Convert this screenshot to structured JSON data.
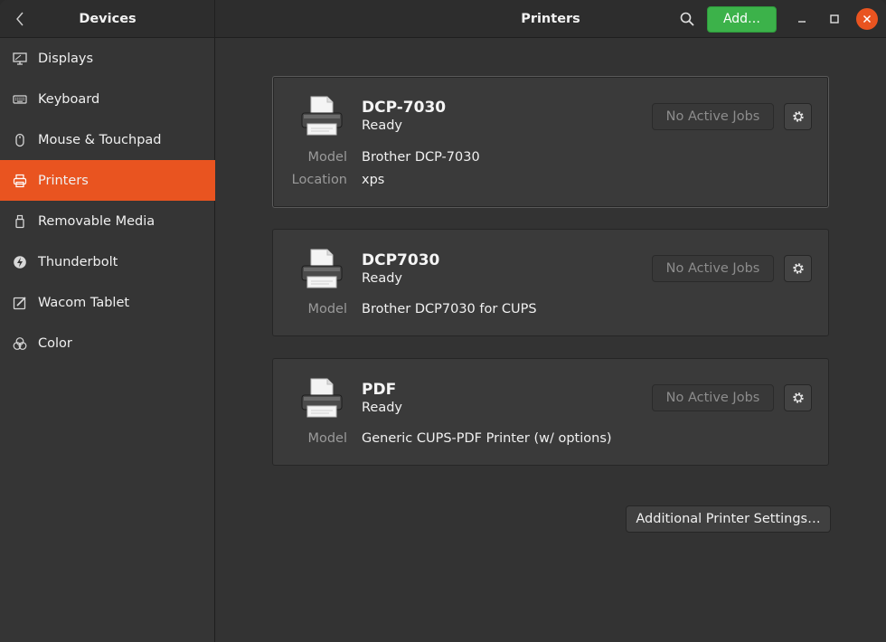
{
  "header": {
    "left_title": "Devices",
    "title": "Printers",
    "add_label": "Add…"
  },
  "sidebar": {
    "items": [
      {
        "label": "Displays",
        "icon": "display-icon"
      },
      {
        "label": "Keyboard",
        "icon": "keyboard-icon"
      },
      {
        "label": "Mouse & Touchpad",
        "icon": "mouse-icon"
      },
      {
        "label": "Printers",
        "icon": "printer-icon",
        "active": true
      },
      {
        "label": "Removable Media",
        "icon": "usb-drive-icon"
      },
      {
        "label": "Thunderbolt",
        "icon": "thunderbolt-icon"
      },
      {
        "label": "Wacom Tablet",
        "icon": "tablet-pen-icon"
      },
      {
        "label": "Color",
        "icon": "color-icon"
      }
    ]
  },
  "printers": [
    {
      "name": "DCP-7030",
      "status": "Ready",
      "jobs_label": "No Active Jobs",
      "model_key": "Model",
      "model": "Brother DCP-7030",
      "location_key": "Location",
      "location": "xps"
    },
    {
      "name": "DCP7030",
      "status": "Ready",
      "jobs_label": "No Active Jobs",
      "model_key": "Model",
      "model": "Brother DCP7030 for CUPS"
    },
    {
      "name": "PDF",
      "status": "Ready",
      "jobs_label": "No Active Jobs",
      "model_key": "Model",
      "model": "Generic CUPS-PDF Printer (w/ options)"
    }
  ],
  "footer": {
    "settings_label": "Additional Printer Settings…"
  },
  "colors": {
    "accent": "#e95420",
    "add_button": "#3cb24a"
  }
}
